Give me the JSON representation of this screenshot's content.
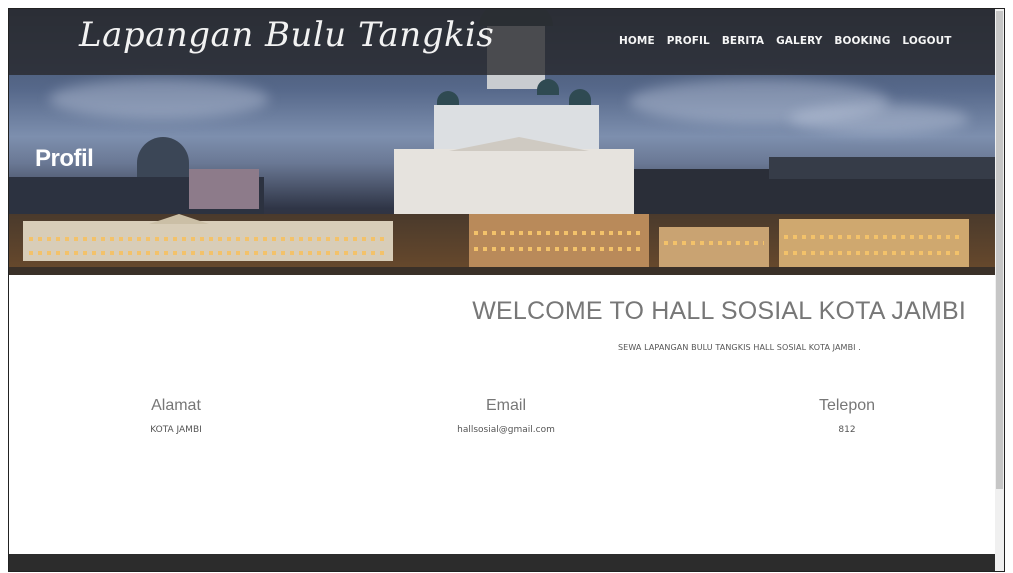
{
  "brand": "Lapangan Bulu Tangkis",
  "nav": [
    "HOME",
    "PROFIL",
    "BERITA",
    "GALERY",
    "BOOKING",
    "LOGOUT"
  ],
  "page_title": "Profil",
  "welcome": {
    "heading": "WELCOME TO HALL SOSIAL KOTA JAMBI",
    "subtitle": "SEWA LAPANGAN BULU TANGKIS HALL SOSIAL KOTA JAMBI ."
  },
  "contact": [
    {
      "label": "Alamat",
      "value": "KOTA JAMBI"
    },
    {
      "label": "Email",
      "value": "hallsosial@gmail.com"
    },
    {
      "label": "Telepon",
      "value": "812"
    }
  ],
  "colors": {
    "nav_bg": "#26262a",
    "footer_bg": "#2c2c2c",
    "text_gray": "#777777"
  }
}
